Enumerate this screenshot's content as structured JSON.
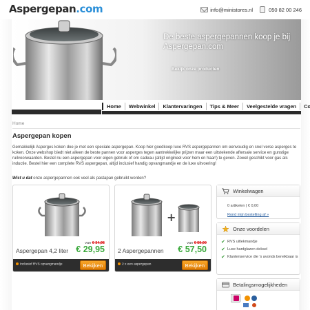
{
  "header": {
    "logo_main": "Aspergepan",
    "logo_tld": ".com",
    "email": "info@ministores.nl",
    "phone": "050 82 00 246"
  },
  "hero": {
    "title_line1": "De beste aspergepannen koop je bij",
    "title_line2": "Aspergepan.com",
    "cta": "Bekijk onze producten"
  },
  "nav": {
    "items": [
      "Home",
      "Webwinkel",
      "Klantervaringen",
      "Tips & Meer",
      "Veelgestelde vragen",
      "Contact"
    ]
  },
  "breadcrumb": "Home",
  "main": {
    "title": "Aspergepan kopen",
    "intro": "Gemakkelijk Asperges koken doe je met een speciale aspergepan. Koop hier goedkoop luxe RVS aspergepannen om eenvoudig en snel verse asperges te koken. Onze webshop biedt niet alleen de beste pannen voor asperges tegen aantrekkelijke prijzen maar een uitstekende aftersale service en gunstige ruilvoorwaarden. Bestel nu een aspergepan voor eigen gebruik of om cadeau (altijd origineel voor hem en haar!) te geven. Zowel geschikt voor gas als inductie. Bestel hier een complete RVS aspergepan, altijd inclusief handig opvangmandje en de luxe uitvoering!",
    "question_bold": "Wist u dat",
    "question_rest": " onze aspergepannen ook veel als pastapan gebruikt worden?"
  },
  "products": [
    {
      "name": "Aspergepan 4,2 liter",
      "was_label": "van",
      "was_price": "€ 34,95",
      "price": "€ 29,95",
      "description": "Inclusief RVS opvangmandje",
      "button": "Bekijken"
    },
    {
      "name": "2 Aspergepannen",
      "was_label": "van",
      "was_price": "€ 59,90",
      "price": "€ 57,50",
      "description": "2 x een aspergepan",
      "button": "Bekijken"
    }
  ],
  "sidebar": {
    "cart": {
      "title": "Winkelwagen",
      "count": "0 artikelen | € 0,00",
      "link": "Rond mijn bestelling af »"
    },
    "advantages": {
      "title": "Onze voordelen",
      "items": [
        "RVS uitlekmandje",
        "Luxe hardglazen deksel",
        "Klantenservice die 's avonds bereikbaar is"
      ]
    },
    "payment": {
      "title": "Betalingsmogelijkheden"
    }
  },
  "colors": {
    "accent_blue": "#2b8fd8",
    "price_green": "#39a83a",
    "button_orange": "#f29100",
    "old_price_red": "#dd1111",
    "nav_dark": "#2b2b2b"
  }
}
